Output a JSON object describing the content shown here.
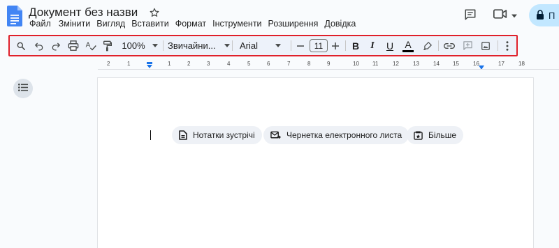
{
  "document": {
    "title": "Документ без назви"
  },
  "menu": [
    {
      "label": "Файл"
    },
    {
      "label": "Змінити"
    },
    {
      "label": "Вигляд"
    },
    {
      "label": "Вставити"
    },
    {
      "label": "Формат"
    },
    {
      "label": "Інструменти"
    },
    {
      "label": "Розширення"
    },
    {
      "label": "Довідка"
    }
  ],
  "share": {
    "label": "П"
  },
  "toolbar": {
    "zoom": "100%",
    "style": "Звичайни...",
    "font": "Arial",
    "font_size": "11",
    "bold": "B",
    "italic": "I",
    "underline": "U",
    "text_color": "A"
  },
  "ruler": {
    "labels": [
      "2",
      "1",
      "1",
      "2",
      "3",
      "4",
      "5",
      "6",
      "7",
      "8",
      "9",
      "10",
      "11",
      "12",
      "13",
      "14",
      "15",
      "16",
      "17",
      "18"
    ]
  },
  "chips": [
    {
      "label": "Нотатки зустрічі",
      "icon": "document-icon"
    },
    {
      "label": "Чернетка електронного листа",
      "icon": "email-icon"
    },
    {
      "label": "Більше",
      "icon": "more-templates-icon"
    }
  ],
  "colors": {
    "accent": "#1a73e8",
    "toolbar_bg": "#edf2fa",
    "highlight_border": "#e0202a",
    "share_bg": "#c2e7ff"
  }
}
